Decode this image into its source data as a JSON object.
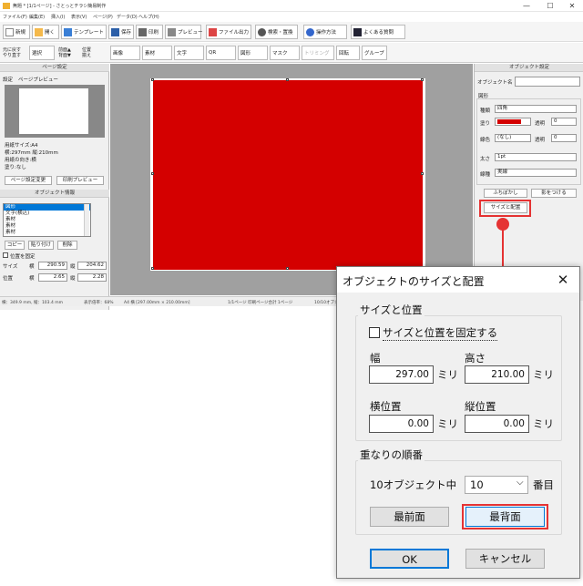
{
  "window": {
    "title": "無題 * [1/1ページ] - さとっとチラシ簡易制作",
    "controls": {
      "minimize": "—",
      "maximize": "☐",
      "close": "✕"
    }
  },
  "menu": [
    "ファイル(F)",
    "編集(E)",
    "挿入(I)",
    "表示(V)",
    "ページ(P)",
    "データ(D)",
    "ヘルプ(H)"
  ],
  "toolbar1": [
    "新規",
    "開く",
    "テンプレート",
    "保存",
    "印刷",
    "プレビュー",
    "ファイル出力",
    "検索・置換",
    "操作方法",
    "よくある質問"
  ],
  "toolbar2": {
    "undo": "元に戻す",
    "redo": "やり直す",
    "select": "選択",
    "front": "前面▲",
    "back": "背面▼",
    "align": "位置",
    "align2": "揃え",
    "tools": [
      "画像",
      "素材",
      "文字",
      "QR",
      "図形",
      "マスク",
      "トリミング",
      "回転",
      "グループ"
    ]
  },
  "left_panel": {
    "page_settings_header": "ページ設定",
    "tabs": [
      "設定",
      "ページプレビュー"
    ],
    "paper_info": [
      "用紙サイズ:A4",
      "横:297mm 縦:210mm",
      "用紙の向き:横",
      "塗り:なし"
    ],
    "page_settings_button": "ページ設定変更",
    "print_preview_button": "印刷プレビュー",
    "object_info_header": "オブジェクト情報",
    "objects": [
      "図形",
      "文字(横込)",
      "素材",
      "素材",
      "素材"
    ],
    "copy_button": "コピー",
    "paste_button": "貼り付け",
    "delete_button": "削除",
    "fix_position_label": "位置を固定",
    "size_label": "サイズ",
    "position_label": "位置",
    "w_label": "横",
    "h_label": "縦",
    "size_w": "290.59",
    "size_h": "204.62",
    "pos_x": "2.65",
    "pos_y": "2.28"
  },
  "status": {
    "coords": "横：349.9 mm, 縦：103.4 mm",
    "zoom": "表示倍率：68%",
    "paper": "A4 横 [297.00mm × 210.00mm]",
    "page": "1/1ページ 印刷ページ合計 1ページ",
    "objects": "10/10オブジ"
  },
  "right_panel": {
    "header": "オブジェクト設定",
    "name_label": "オブジェクト名",
    "name_value": "",
    "section_label": "図形",
    "type_label": "種類",
    "type_value": "四角",
    "fill_label": "塗り",
    "transparency_label": "透明",
    "fill_transparency": "0",
    "line_color_label": "線色",
    "line_color_value": "(なし)",
    "line_transparency": "0",
    "thickness_label": "太さ",
    "thickness_value": "1pt",
    "line_type_label": "線種",
    "line_type_value": "実線",
    "blur_button": "ふちぼかし",
    "shadow_button": "影をつける",
    "size_position_button": "サイズと配置"
  },
  "dialog": {
    "title": "オブジェクトのサイズと配置",
    "close": "✕",
    "size_group": "サイズと位置",
    "fix_checkbox_label": "サイズと位置を固定する",
    "width_label": "幅",
    "height_label": "高さ",
    "width_value": "297.00",
    "height_value": "210.00",
    "x_label": "横位置",
    "y_label": "縦位置",
    "x_value": "0.00",
    "y_value": "0.00",
    "unit": "ミリ",
    "order_group": "重なりの順番",
    "order_text": "10オブジェクト中",
    "order_value": "10",
    "order_unit": "番目",
    "front_button": "最前面",
    "back_button": "最背面",
    "ok_button": "OK",
    "cancel_button": "キャンセル"
  },
  "colors": {
    "shape_fill": "#d40000",
    "highlight": "#e53333",
    "accent": "#0078d7"
  },
  "icons": [
    "app-icon",
    "new-file-icon",
    "open-icon",
    "template-icon",
    "save-icon",
    "print-icon",
    "preview-icon",
    "export-icon",
    "search-icon",
    "help-icon",
    "faq-icon"
  ]
}
